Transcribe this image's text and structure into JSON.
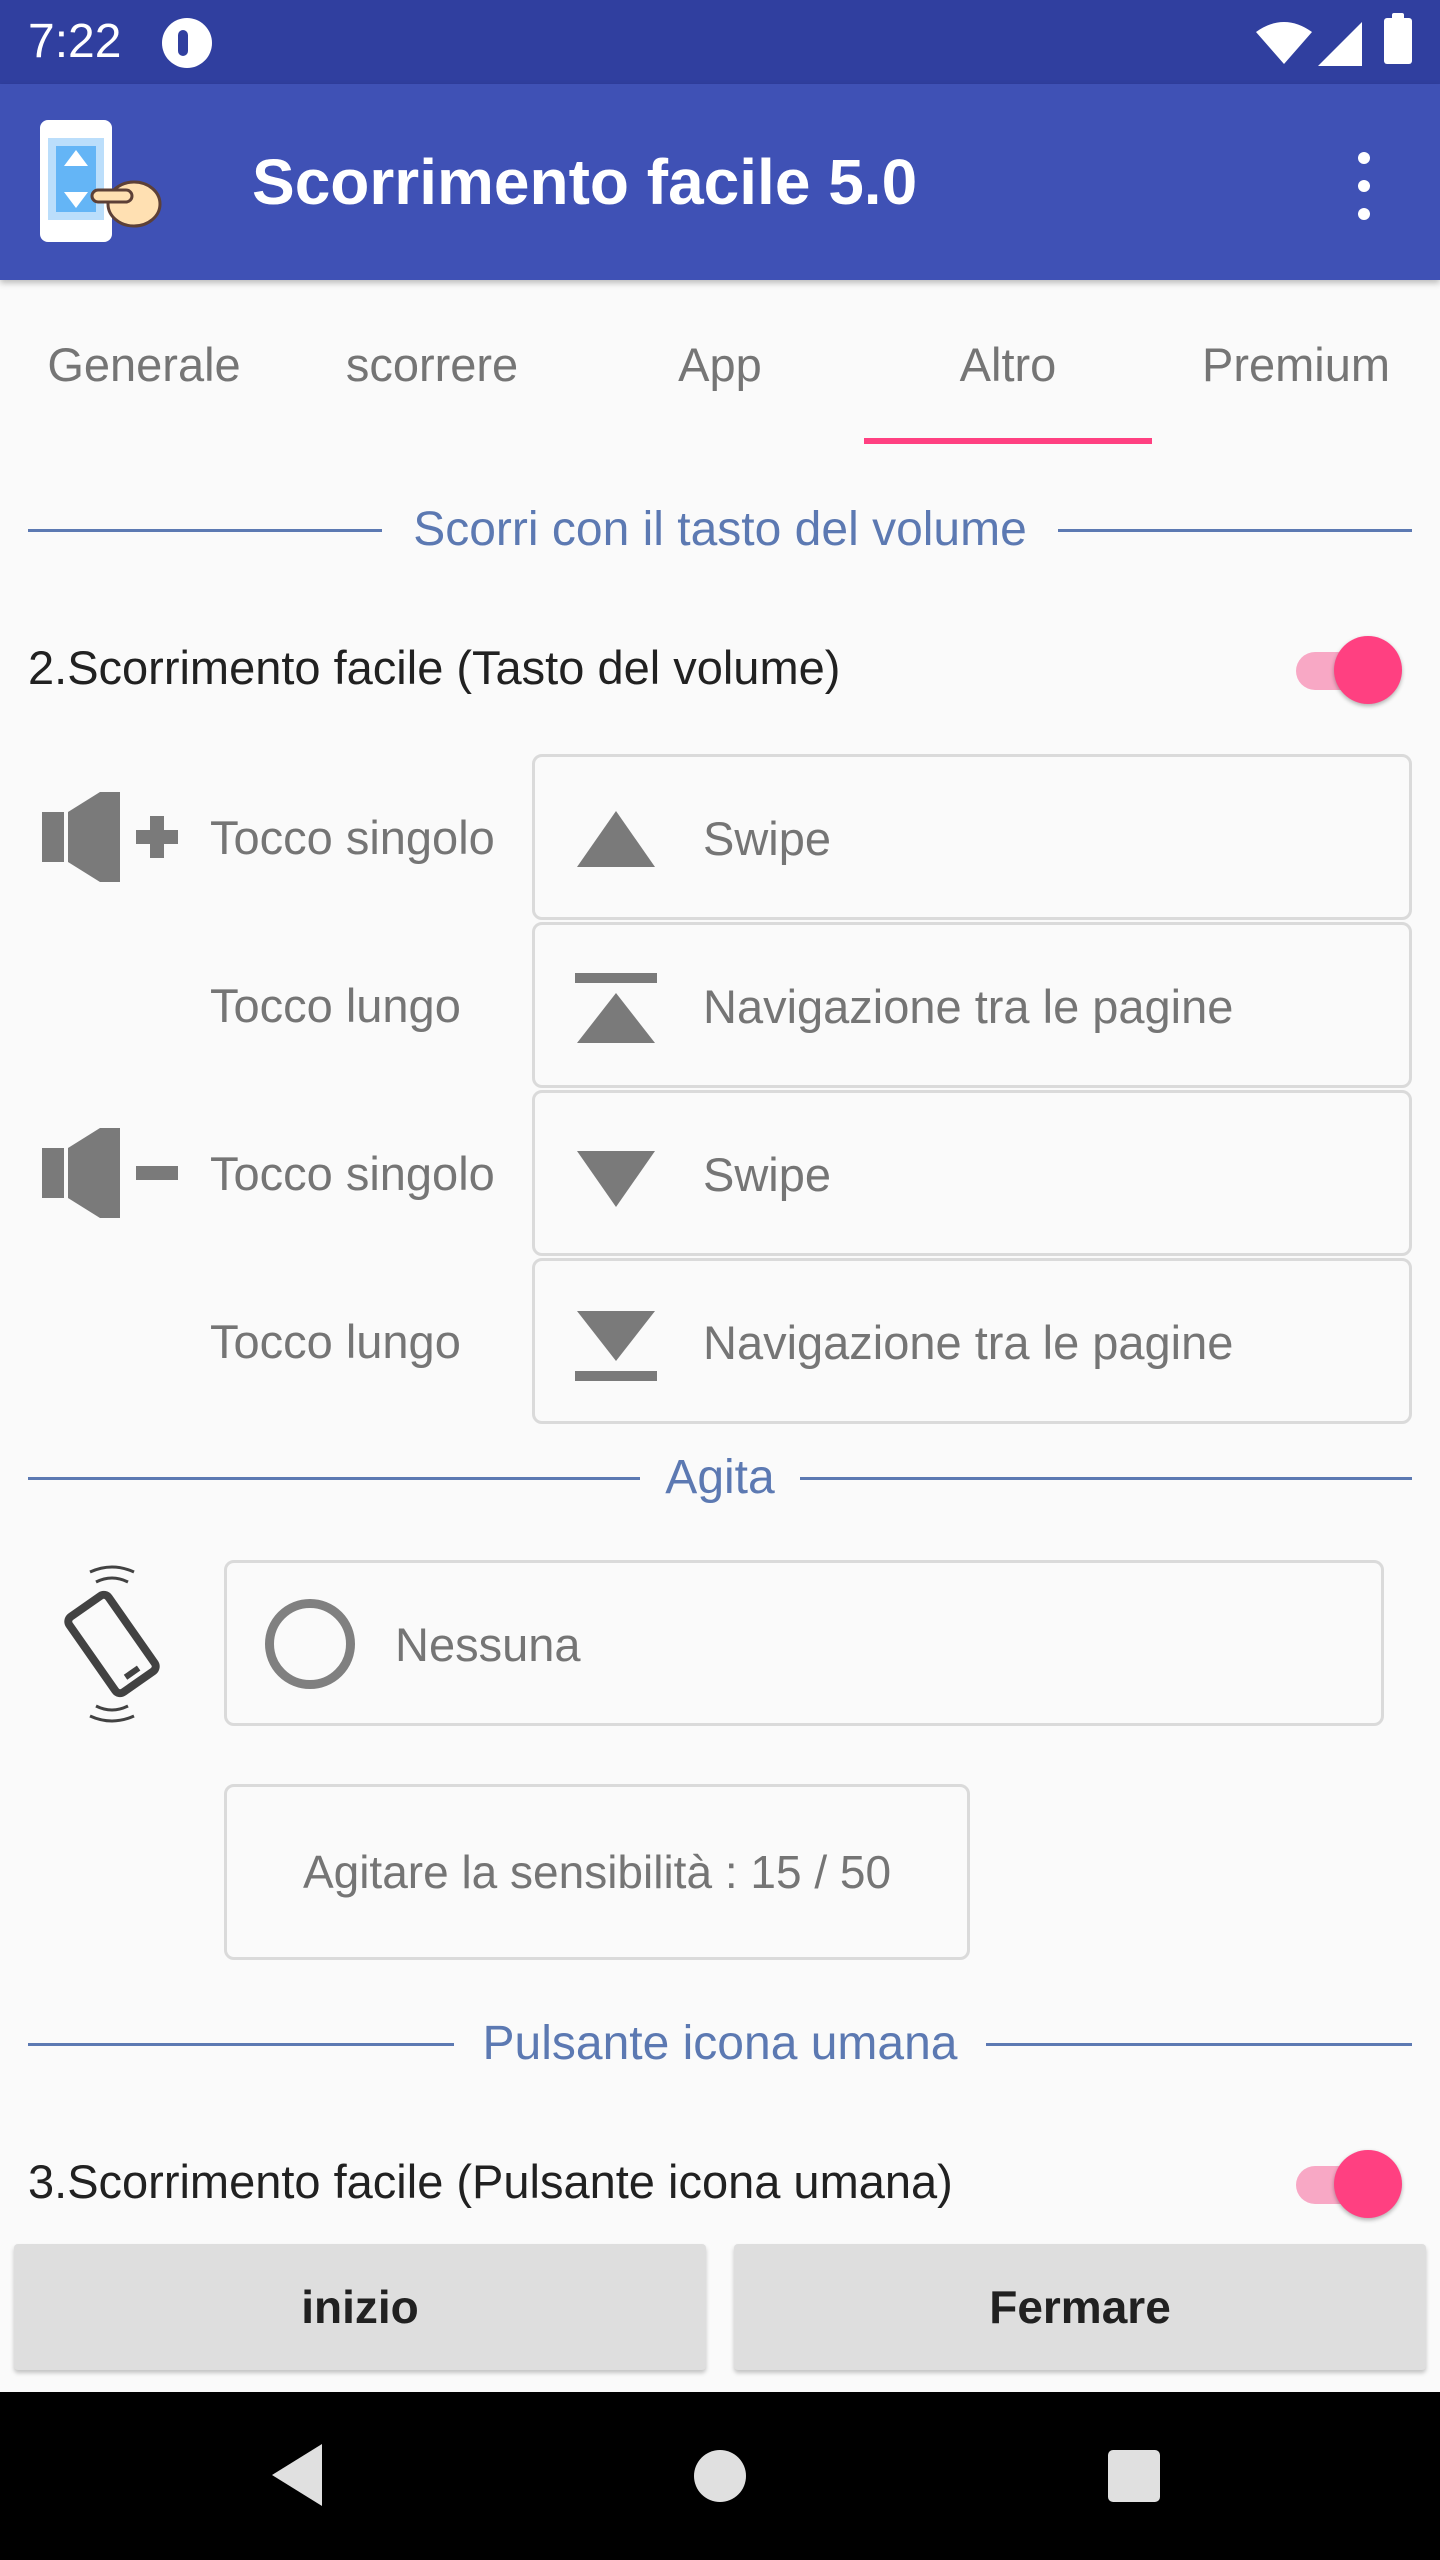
{
  "status_bar": {
    "time": "7:22",
    "icons": [
      "notification-icon",
      "wifi-icon",
      "signal-icon",
      "battery-icon"
    ]
  },
  "app_bar": {
    "title": "Scorrimento facile 5.0",
    "app_icon": "app-logo-icon",
    "menu_icon": "more-vert-icon"
  },
  "tabs": [
    {
      "label": "Generale"
    },
    {
      "label": "scorrere"
    },
    {
      "label": "App"
    },
    {
      "label": "Altro",
      "selected": true
    },
    {
      "label": "Premium"
    }
  ],
  "colors": {
    "primary": "#3F51B5",
    "primary_dark": "#303F9F",
    "accent": "#FF4081",
    "section_line": "#5C79B2"
  },
  "volume_section": {
    "header": "Scorri con il tasto del volume",
    "toggle_label": "2.Scorrimento facile (Tasto del volume)",
    "toggle_on": true,
    "rows": [
      {
        "icon": "volume-up-icon",
        "label": "Tocco singolo",
        "action_icon": "arrow-up-icon",
        "action": "Swipe"
      },
      {
        "icon": "",
        "label": "Tocco lungo",
        "action_icon": "page-up-icon",
        "action": "Navigazione tra le pagine"
      },
      {
        "icon": "volume-down-icon",
        "label": "Tocco singolo",
        "action_icon": "arrow-down-icon",
        "action": "Swipe"
      },
      {
        "icon": "",
        "label": "Tocco lungo",
        "action_icon": "page-down-icon",
        "action": "Navigazione tra le pagine"
      }
    ]
  },
  "shake_section": {
    "header": "Agita",
    "icon": "shake-phone-icon",
    "option": "Nessuna",
    "sensitivity": "Agitare la sensibilità : 15 / 50"
  },
  "human_icon_section": {
    "header": "Pulsante icona umana",
    "toggle_label": "3.Scorrimento facile (Pulsante icona umana)",
    "toggle_on": true
  },
  "buttons": {
    "start": "inizio",
    "stop": "Fermare"
  },
  "nav_bar": {
    "icons": [
      "back-icon",
      "home-icon",
      "recents-icon"
    ]
  }
}
